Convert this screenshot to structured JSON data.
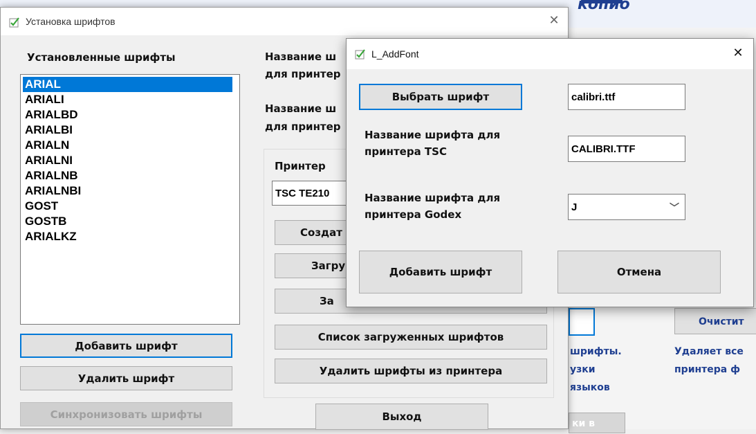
{
  "background": {
    "title_fragments": [
      "копио"
    ],
    "right_texts": [
      "шрифты.",
      "узки",
      "языков",
      "Удаляет все",
      "принтера ф"
    ],
    "clear_button": "Очистит",
    "partial_button": "ки в"
  },
  "fonts_window": {
    "title": "Установка шрифтов",
    "installed_label": "Установленные шрифты",
    "fonts": [
      "ARIAL",
      "ARIALI",
      "ARIALBD",
      "ARIALBI",
      "ARIALN",
      "ARIALNI",
      "ARIALNB",
      "ARIALNBI",
      "GOST",
      "GOSTB",
      "ARIALKZ"
    ],
    "selected_font": "ARIAL",
    "add_button": "Добавить шрифт",
    "delete_button": "Удалить шрифт",
    "sync_button": "Синхронизовать шрифты",
    "name_label_1a": "Название ш",
    "name_label_1b": "для принтер",
    "name_label_2a": "Название ш",
    "name_label_2b": "для принтер",
    "printer_group_label": "Принтер",
    "printer_value": "TSC TE210",
    "create_button": "Создат",
    "load_button_1": "Загру",
    "load_button_2": "За",
    "loaded_list_button": "Список загруженных шрифтов",
    "remove_from_printer_button": "Удалить шрифты из принтера",
    "exit_button": "Выход"
  },
  "addfont_dialog": {
    "title": "L_AddFont",
    "choose_button": "Выбрать шрифт",
    "file_value": "calibri.ttf",
    "tsc_label": "Название шрифта для принтера TSC",
    "tsc_value": "CALIBRI.TTF",
    "godex_label": "Название шрифта для принтера Godex",
    "godex_value": "J",
    "add_button": "Добавить шрифт",
    "cancel_button": "Отмена"
  },
  "colors": {
    "accent": "#0078d7",
    "brand_blue": "#1f3f91",
    "check_green": "#3aa53a"
  }
}
